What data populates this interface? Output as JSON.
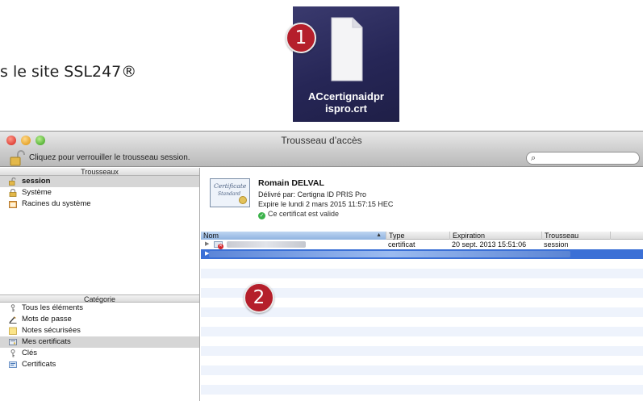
{
  "document": {
    "visible_text": "s le site SSL247®"
  },
  "desktop_file": {
    "icon": "document-file-icon",
    "name_line1": "ACcertignaidpr",
    "name_line2": "ispro.crt"
  },
  "markers": {
    "one": "1",
    "two": "2"
  },
  "window": {
    "title": "Trousseau d’accès",
    "lock_label": "Cliquez pour verrouiller le trousseau session.",
    "search_placeholder": ""
  },
  "sidebar": {
    "keychains_header": "Trousseaux",
    "keychains": [
      {
        "label": "session",
        "icon": "keychain-unlocked-icon"
      },
      {
        "label": "Système",
        "icon": "lock-icon"
      },
      {
        "label": "Racines du système",
        "icon": "folder-icon"
      }
    ],
    "category_header": "Catégorie",
    "categories": [
      {
        "label": "Tous les éléments",
        "icon": "all-items-icon"
      },
      {
        "label": "Mots de passe",
        "icon": "key-pen-icon"
      },
      {
        "label": "Notes sécurisées",
        "icon": "note-icon"
      },
      {
        "label": "Mes certificats",
        "icon": "my-certificates-icon"
      },
      {
        "label": "Clés",
        "icon": "key-icon"
      },
      {
        "label": "Certificats",
        "icon": "certificate-icon"
      }
    ]
  },
  "certificate": {
    "name": "Romain DELVAL",
    "issued_by": "Délivré par: Certigna ID PRIS Pro",
    "expires": "Expire le lundi 2 mars 2015 11:57:15 HEC",
    "status": "Ce certificat est valide",
    "image_text1": "Certificate",
    "image_text2": "Standard"
  },
  "table": {
    "headers": {
      "name": "Nom",
      "type": "Type",
      "expiration": "Expiration",
      "keychain": "Trousseau"
    },
    "rows": [
      {
        "type": "certificat",
        "expiration": "20 sept. 2013 15:51:06",
        "keychain": "session"
      }
    ]
  },
  "colors": {
    "selection_blue": "#3b70d6",
    "marker_red": "#b51f2b",
    "stripe": "#eef3fc"
  }
}
